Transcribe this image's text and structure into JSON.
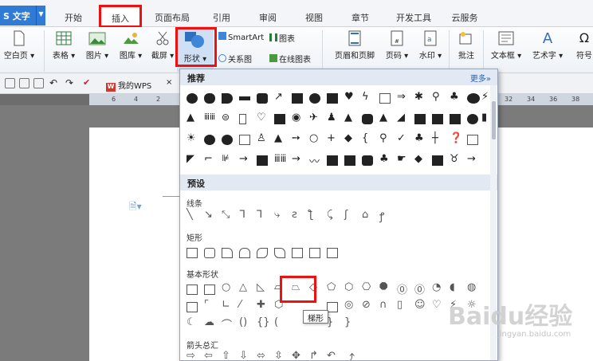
{
  "app": {
    "name": "S 文字"
  },
  "tabs": [
    "开始",
    "插入",
    "页面布局",
    "引用",
    "审阅",
    "视图",
    "章节",
    "开发工具",
    "云服务"
  ],
  "ribbon": {
    "blank_page": "空白页",
    "table": "表格",
    "picture": "图片",
    "gallery": "图库",
    "screenshot": "截屏",
    "shapes": "形状",
    "smartart": "SmartArt",
    "chart": "图表",
    "relation": "关系图",
    "online_chart": "在线图表",
    "header_footer": "页眉和页脚",
    "page_number": "页码",
    "watermark": "水印",
    "comment": "批注",
    "textbox": "文本框",
    "wordart": "艺术字",
    "symbol": "符号"
  },
  "quickbar": {
    "doc_tab": "我的WPS"
  },
  "ruler": {
    "left_ticks": [
      "6",
      "4",
      "2"
    ],
    "right_ticks": [
      "32",
      "34",
      "36",
      "38"
    ]
  },
  "panel": {
    "recommended": "推荐",
    "more": "更多»",
    "presets": "预设",
    "lines": "线条",
    "rectangles": "矩形",
    "basic_shapes": "基本形状",
    "arrows": "箭头总汇",
    "tooltip": "梯形"
  },
  "watermark": {
    "brand": "Baidu经验",
    "url": "jingyan.baidu.com"
  },
  "colors": {
    "accent": "#2f7bd6",
    "highlight": "#ee1111"
  }
}
